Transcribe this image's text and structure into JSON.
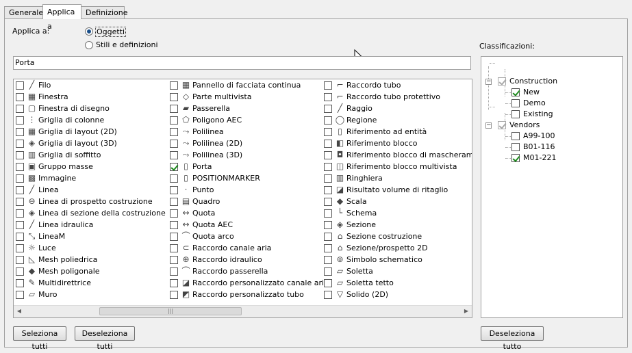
{
  "tabs": [
    {
      "label": "Generale"
    },
    {
      "label": "Applica a"
    },
    {
      "label": "Definizione"
    }
  ],
  "apply_to": {
    "label": "Applica a:",
    "option_objects": "Oggetti",
    "option_styles": "Stili e definizioni",
    "selected": "Oggetti"
  },
  "filter_text": "Porta",
  "columns": [
    [
      {
        "label": "Filo",
        "icon": "wire-icon",
        "checked": false
      },
      {
        "label": "Finestra",
        "icon": "window-icon",
        "checked": false
      },
      {
        "label": "Finestra di disegno",
        "icon": "viewport-icon",
        "checked": false
      },
      {
        "label": "Griglia di colonne",
        "icon": "column-grid-icon",
        "checked": false
      },
      {
        "label": "Griglia di layout (2D)",
        "icon": "layout-grid-2d-icon",
        "checked": false
      },
      {
        "label": "Griglia di layout (3D)",
        "icon": "layout-grid-3d-icon",
        "checked": false
      },
      {
        "label": "Griglia di soffitto",
        "icon": "ceiling-grid-icon",
        "checked": false
      },
      {
        "label": "Gruppo masse",
        "icon": "mass-group-icon",
        "checked": false
      },
      {
        "label": "Immagine",
        "icon": "image-icon",
        "checked": false
      },
      {
        "label": "Linea",
        "icon": "line-icon",
        "checked": false
      },
      {
        "label": "Linea di prospetto costruzione",
        "icon": "elevation-line-icon",
        "checked": false
      },
      {
        "label": "Linea di sezione della costruzione",
        "icon": "section-line-icon",
        "checked": false
      },
      {
        "label": "Linea idraulica",
        "icon": "pipe-line-icon",
        "checked": false
      },
      {
        "label": "LineaM",
        "icon": "mline-icon",
        "checked": false
      },
      {
        "label": "Luce",
        "icon": "light-icon",
        "checked": false
      },
      {
        "label": "Mesh poliedrica",
        "icon": "polyface-mesh-icon",
        "checked": false
      },
      {
        "label": "Mesh poligonale",
        "icon": "polygon-mesh-icon",
        "checked": false
      },
      {
        "label": "Multidirettrice",
        "icon": "multileader-icon",
        "checked": false
      },
      {
        "label": "Muro",
        "icon": "wall-icon",
        "checked": false
      }
    ],
    [
      {
        "label": "Pannello di facciata continua",
        "icon": "curtain-wall-panel-icon",
        "checked": false
      },
      {
        "label": "Parte multivista",
        "icon": "multiview-part-icon",
        "checked": false
      },
      {
        "label": "Passerella",
        "icon": "cable-tray-icon",
        "checked": false
      },
      {
        "label": "Poligono AEC",
        "icon": "aec-polygon-icon",
        "checked": false
      },
      {
        "label": "Polilinea",
        "icon": "polyline-icon",
        "checked": false
      },
      {
        "label": "Polilinea (2D)",
        "icon": "polyline-2d-icon",
        "checked": false
      },
      {
        "label": "Polilinea (3D)",
        "icon": "polyline-3d-icon",
        "checked": false
      },
      {
        "label": "Porta",
        "icon": "door-icon",
        "checked": true
      },
      {
        "label": "POSITIONMARKER",
        "icon": "position-marker-icon",
        "checked": false
      },
      {
        "label": "Punto",
        "icon": "point-icon",
        "checked": false
      },
      {
        "label": "Quadro",
        "icon": "panel-icon",
        "checked": false
      },
      {
        "label": "Quota",
        "icon": "dimension-icon",
        "checked": false
      },
      {
        "label": "Quota AEC",
        "icon": "aec-dimension-icon",
        "checked": false
      },
      {
        "label": "Quota arco",
        "icon": "arc-dimension-icon",
        "checked": false
      },
      {
        "label": "Raccordo canale aria",
        "icon": "duct-fitting-icon",
        "checked": false
      },
      {
        "label": "Raccordo idraulico",
        "icon": "pipe-fitting-icon",
        "checked": false
      },
      {
        "label": "Raccordo passerella",
        "icon": "cable-tray-fitting-icon",
        "checked": false
      },
      {
        "label": "Raccordo personalizzato canale aria",
        "icon": "custom-duct-fitting-icon",
        "checked": false
      },
      {
        "label": "Raccordo personalizzato tubo",
        "icon": "custom-pipe-fitting-icon",
        "checked": false
      }
    ],
    [
      {
        "label": "Raccordo tubo",
        "icon": "conduit-fitting-icon",
        "checked": false
      },
      {
        "label": "Raccordo tubo protettivo",
        "icon": "protective-fitting-icon",
        "checked": false
      },
      {
        "label": "Raggio",
        "icon": "radius-icon",
        "checked": false
      },
      {
        "label": "Regione",
        "icon": "region-icon",
        "checked": false
      },
      {
        "label": "Riferimento ad entità",
        "icon": "entity-reference-icon",
        "checked": false
      },
      {
        "label": "Riferimento blocco",
        "icon": "block-reference-icon",
        "checked": false
      },
      {
        "label": "Riferimento blocco di mascheramento",
        "icon": "mask-block-icon",
        "checked": false
      },
      {
        "label": "Riferimento blocco multivista",
        "icon": "multiview-block-icon",
        "checked": false
      },
      {
        "label": "Ringhiera",
        "icon": "railing-icon",
        "checked": false
      },
      {
        "label": "Risultato volume di ritaglio",
        "icon": "clip-volume-icon",
        "checked": false
      },
      {
        "label": "Scala",
        "icon": "stair-icon",
        "checked": false
      },
      {
        "label": "Schema",
        "icon": "schematic-icon",
        "checked": false
      },
      {
        "label": "Sezione",
        "icon": "section-icon",
        "checked": false
      },
      {
        "label": "Sezione costruzione",
        "icon": "building-section-icon",
        "checked": false
      },
      {
        "label": "Sezione/prospetto 2D",
        "icon": "section-elevation-2d-icon",
        "checked": false
      },
      {
        "label": "Simbolo schematico",
        "icon": "schematic-symbol-icon",
        "checked": false
      },
      {
        "label": "Soletta",
        "icon": "slab-icon",
        "checked": false
      },
      {
        "label": "Soletta tetto",
        "icon": "roof-slab-icon",
        "checked": false
      },
      {
        "label": "Solido (2D)",
        "icon": "solid-2d-icon",
        "checked": false
      }
    ]
  ],
  "buttons": {
    "select_all": "Seleziona tutti",
    "deselect_all": "Deseleziona tutti",
    "deselect_all_tree": "Deseleziona tutto"
  },
  "classifications": {
    "label": "Classificazioni:",
    "groups": [
      {
        "name": "Construction",
        "checked": true,
        "items": [
          {
            "name": "New",
            "checked": true
          },
          {
            "name": "Demo",
            "checked": false
          },
          {
            "name": "Existing",
            "checked": false
          }
        ]
      },
      {
        "name": "Vendors",
        "checked": true,
        "items": [
          {
            "name": "A99-100",
            "checked": false
          },
          {
            "name": "B01-116",
            "checked": false
          },
          {
            "name": "M01-221",
            "checked": true
          }
        ]
      }
    ]
  }
}
